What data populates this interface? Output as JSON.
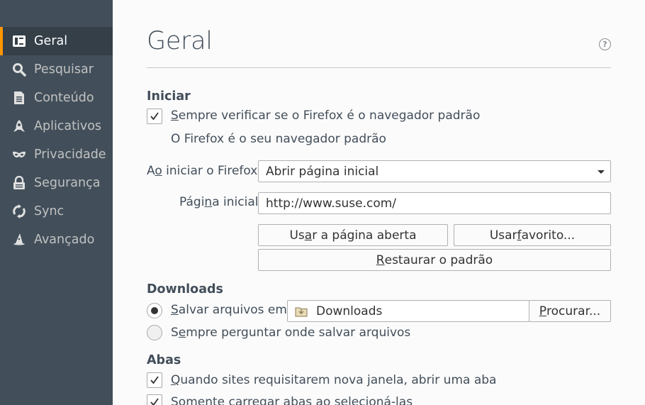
{
  "sidebar": {
    "items": [
      {
        "label": "Geral",
        "icon": "general-icon",
        "active": true
      },
      {
        "label": "Pesquisar",
        "icon": "search-icon"
      },
      {
        "label": "Conteúdo",
        "icon": "content-icon"
      },
      {
        "label": "Aplicativos",
        "icon": "applications-icon"
      },
      {
        "label": "Privacidade",
        "icon": "privacy-mask-icon"
      },
      {
        "label": "Segurança",
        "icon": "lock-icon"
      },
      {
        "label": "Sync",
        "icon": "sync-icon"
      },
      {
        "label": "Avançado",
        "icon": "advanced-wizard-hat-icon"
      }
    ]
  },
  "main": {
    "title": "Geral",
    "help": "?",
    "startup": {
      "heading": "Iniciar",
      "default_check": {
        "pre": "",
        "accel": "S",
        "post": "empre verificar se o Firefox é o navegador padrão",
        "checked": true
      },
      "default_status": "O Firefox é o seu navegador padrão",
      "on_start": {
        "label_pre": "A",
        "label_accel": "o",
        "label_post": " iniciar o Firefox:",
        "value": "Abrir página inicial"
      },
      "homepage": {
        "label_pre": "Pági",
        "label_accel": "n",
        "label_post": "a inicial:",
        "value": "http://www.suse.com/"
      },
      "use_current": {
        "pre": "Us",
        "accel": "a",
        "post": "r a página aberta"
      },
      "use_bookmark": {
        "pre": "Usar ",
        "accel": "f",
        "post": "avorito..."
      },
      "restore_default": {
        "pre": "",
        "accel": "R",
        "post": "estaurar o padrão"
      }
    },
    "downloads": {
      "heading": "Downloads",
      "save_to": {
        "pre": "",
        "accel": "S",
        "post": "alvar arquivos em",
        "selected": true
      },
      "folder": "Downloads",
      "browse": {
        "pre": "",
        "accel": "P",
        "post": "rocurar..."
      },
      "always_ask": {
        "pre": "S",
        "accel": "e",
        "post": "mpre perguntar onde salvar arquivos",
        "selected": false
      }
    },
    "tabs": {
      "heading": "Abas",
      "new_window_tab": {
        "pre": "",
        "accel": "Q",
        "post": "uando sites requisitarem nova janela, abrir uma aba",
        "checked": true
      },
      "load_selected": {
        "pre": "S",
        "accel": "o",
        "post": "mente carregar abas ao selecioná-las",
        "checked": true
      }
    }
  },
  "colors": {
    "sidebar_bg": "#424f5a",
    "sidebar_active_bg": "#343f48",
    "accent": "#ff9500",
    "text": "#424e5a"
  }
}
